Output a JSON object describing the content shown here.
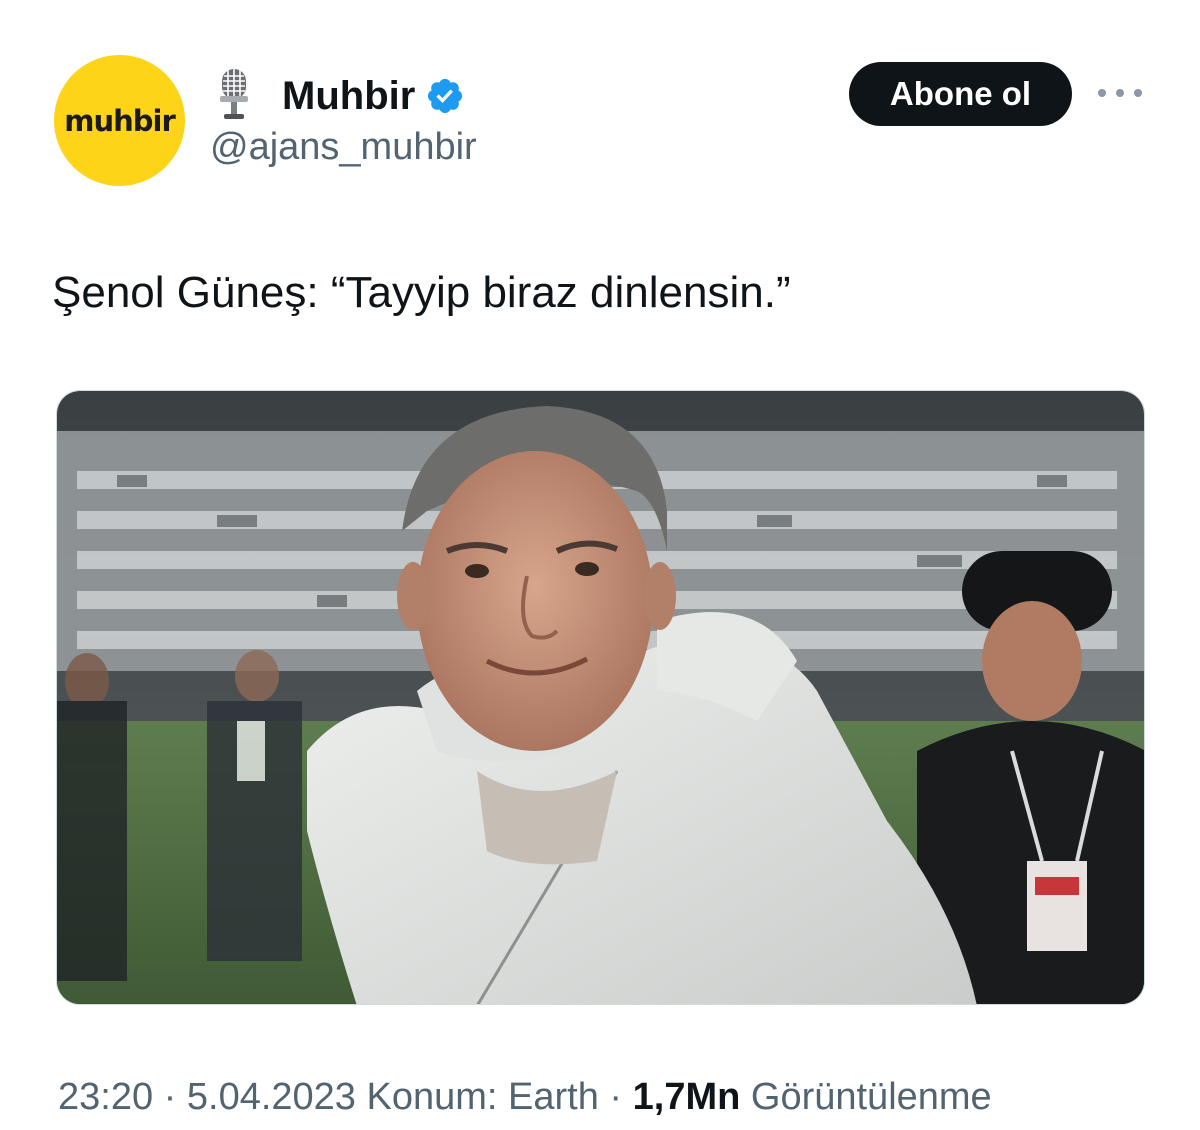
{
  "colors": {
    "avatar_bg": "#fdd418",
    "verified": "#1d9bf0",
    "button_bg": "#0f1419",
    "secondary_text": "#536471"
  },
  "account": {
    "avatar_text": "muhbir",
    "display_name": "Muhbir",
    "handle": "@ajans_muhbir",
    "name_emoji_icon": "microphone-icon",
    "verified_icon": "verified-badge-icon"
  },
  "actions": {
    "subscribe_label": "Abone ol",
    "more_icon": "more-options-icon"
  },
  "tweet": {
    "text": "Şenol Güneş: “Tayyip biraz dinlensin.”"
  },
  "media": {
    "type": "photo"
  },
  "meta": {
    "time": "23:20",
    "sep1": " · ",
    "date": "5.04.2023",
    "location": " Konum: Earth",
    "sep2": " · ",
    "views_count": "1,7Mn",
    "views_label": " Görüntülenme"
  }
}
